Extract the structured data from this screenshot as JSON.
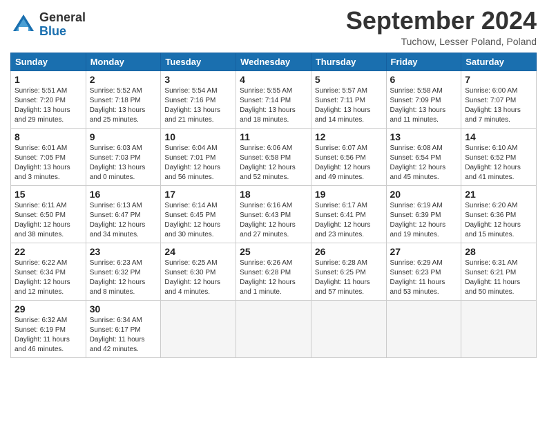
{
  "logo": {
    "general": "General",
    "blue": "Blue"
  },
  "title": "September 2024",
  "location": "Tuchow, Lesser Poland, Poland",
  "weekdays": [
    "Sunday",
    "Monday",
    "Tuesday",
    "Wednesday",
    "Thursday",
    "Friday",
    "Saturday"
  ],
  "weeks": [
    [
      {
        "day": "1",
        "sunrise": "5:51 AM",
        "sunset": "7:20 PM",
        "daylight": "13 hours and 29 minutes."
      },
      {
        "day": "2",
        "sunrise": "5:52 AM",
        "sunset": "7:18 PM",
        "daylight": "13 hours and 25 minutes."
      },
      {
        "day": "3",
        "sunrise": "5:54 AM",
        "sunset": "7:16 PM",
        "daylight": "13 hours and 21 minutes."
      },
      {
        "day": "4",
        "sunrise": "5:55 AM",
        "sunset": "7:14 PM",
        "daylight": "13 hours and 18 minutes."
      },
      {
        "day": "5",
        "sunrise": "5:57 AM",
        "sunset": "7:11 PM",
        "daylight": "13 hours and 14 minutes."
      },
      {
        "day": "6",
        "sunrise": "5:58 AM",
        "sunset": "7:09 PM",
        "daylight": "13 hours and 11 minutes."
      },
      {
        "day": "7",
        "sunrise": "6:00 AM",
        "sunset": "7:07 PM",
        "daylight": "13 hours and 7 minutes."
      }
    ],
    [
      {
        "day": "8",
        "sunrise": "6:01 AM",
        "sunset": "7:05 PM",
        "daylight": "13 hours and 3 minutes."
      },
      {
        "day": "9",
        "sunrise": "6:03 AM",
        "sunset": "7:03 PM",
        "daylight": "13 hours and 0 minutes."
      },
      {
        "day": "10",
        "sunrise": "6:04 AM",
        "sunset": "7:01 PM",
        "daylight": "12 hours and 56 minutes."
      },
      {
        "day": "11",
        "sunrise": "6:06 AM",
        "sunset": "6:58 PM",
        "daylight": "12 hours and 52 minutes."
      },
      {
        "day": "12",
        "sunrise": "6:07 AM",
        "sunset": "6:56 PM",
        "daylight": "12 hours and 49 minutes."
      },
      {
        "day": "13",
        "sunrise": "6:08 AM",
        "sunset": "6:54 PM",
        "daylight": "12 hours and 45 minutes."
      },
      {
        "day": "14",
        "sunrise": "6:10 AM",
        "sunset": "6:52 PM",
        "daylight": "12 hours and 41 minutes."
      }
    ],
    [
      {
        "day": "15",
        "sunrise": "6:11 AM",
        "sunset": "6:50 PM",
        "daylight": "12 hours and 38 minutes."
      },
      {
        "day": "16",
        "sunrise": "6:13 AM",
        "sunset": "6:47 PM",
        "daylight": "12 hours and 34 minutes."
      },
      {
        "day": "17",
        "sunrise": "6:14 AM",
        "sunset": "6:45 PM",
        "daylight": "12 hours and 30 minutes."
      },
      {
        "day": "18",
        "sunrise": "6:16 AM",
        "sunset": "6:43 PM",
        "daylight": "12 hours and 27 minutes."
      },
      {
        "day": "19",
        "sunrise": "6:17 AM",
        "sunset": "6:41 PM",
        "daylight": "12 hours and 23 minutes."
      },
      {
        "day": "20",
        "sunrise": "6:19 AM",
        "sunset": "6:39 PM",
        "daylight": "12 hours and 19 minutes."
      },
      {
        "day": "21",
        "sunrise": "6:20 AM",
        "sunset": "6:36 PM",
        "daylight": "12 hours and 15 minutes."
      }
    ],
    [
      {
        "day": "22",
        "sunrise": "6:22 AM",
        "sunset": "6:34 PM",
        "daylight": "12 hours and 12 minutes."
      },
      {
        "day": "23",
        "sunrise": "6:23 AM",
        "sunset": "6:32 PM",
        "daylight": "12 hours and 8 minutes."
      },
      {
        "day": "24",
        "sunrise": "6:25 AM",
        "sunset": "6:30 PM",
        "daylight": "12 hours and 4 minutes."
      },
      {
        "day": "25",
        "sunrise": "6:26 AM",
        "sunset": "6:28 PM",
        "daylight": "12 hours and 1 minute."
      },
      {
        "day": "26",
        "sunrise": "6:28 AM",
        "sunset": "6:25 PM",
        "daylight": "11 hours and 57 minutes."
      },
      {
        "day": "27",
        "sunrise": "6:29 AM",
        "sunset": "6:23 PM",
        "daylight": "11 hours and 53 minutes."
      },
      {
        "day": "28",
        "sunrise": "6:31 AM",
        "sunset": "6:21 PM",
        "daylight": "11 hours and 50 minutes."
      }
    ],
    [
      {
        "day": "29",
        "sunrise": "6:32 AM",
        "sunset": "6:19 PM",
        "daylight": "11 hours and 46 minutes."
      },
      {
        "day": "30",
        "sunrise": "6:34 AM",
        "sunset": "6:17 PM",
        "daylight": "11 hours and 42 minutes."
      },
      null,
      null,
      null,
      null,
      null
    ]
  ]
}
